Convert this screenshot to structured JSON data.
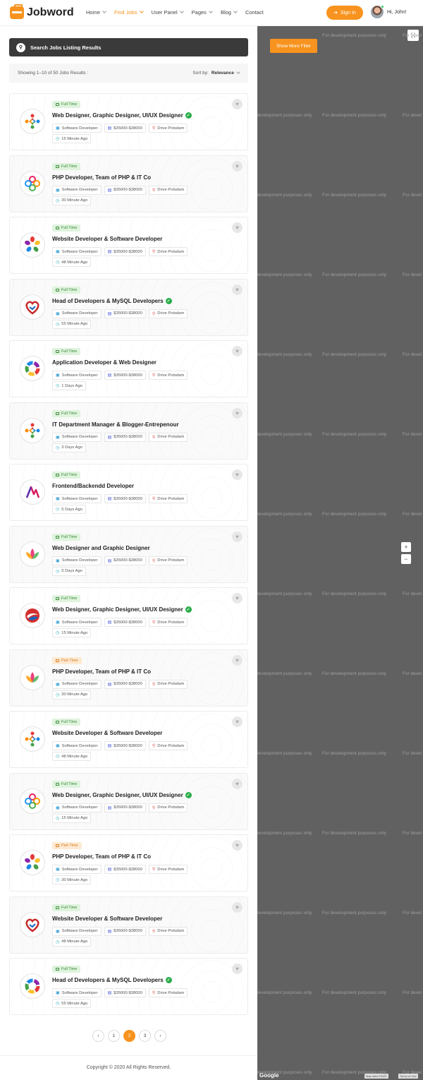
{
  "header": {
    "logo_text": "Jobword",
    "nav": [
      {
        "label": "Home",
        "active": false
      },
      {
        "label": "Find Jobs",
        "active": true
      },
      {
        "label": "User Panel",
        "active": false
      },
      {
        "label": "Pages",
        "active": false
      },
      {
        "label": "Blog",
        "active": false
      },
      {
        "label": "Contact",
        "active": false
      }
    ],
    "signin_label": "Sign In",
    "user_greeting": "Hi, John!"
  },
  "search_bar": {
    "label": "Search Jobs Listing Results"
  },
  "results": {
    "summary": "Showing 1–10 of 50 Jobs Results :",
    "sort_label": "Sort by:",
    "sort_value": "Relevance"
  },
  "jobs": [
    {
      "type": "Full Time",
      "kind": "full",
      "title": "Web Designer, Graphic Designer, UI/UX Designer",
      "verified": true,
      "category": "Software Developer",
      "salary": "$35000-$38000",
      "location": "Drive Potsdam",
      "posted": "15 Minute Ago",
      "logo": "people-logo"
    },
    {
      "type": "Full Time",
      "kind": "full",
      "title": "PHP Developer, Team of PHP & IT Co",
      "verified": false,
      "category": "Software Developer",
      "salary": "$35000-$38000",
      "location": "Drive Potsdam",
      "posted": "30 Minute Ago",
      "logo": "flower-logo"
    },
    {
      "type": "Full Time",
      "kind": "full",
      "title": "Website Developer & Software Developer",
      "verified": false,
      "category": "Software Developer",
      "salary": "$35000-$38000",
      "location": "Drive Potsdam",
      "posted": "48 Minute Ago",
      "logo": "petals-logo"
    },
    {
      "type": "Full Time",
      "kind": "full",
      "title": "Head of Developers & MySQL Developers",
      "verified": true,
      "category": "Software Developer",
      "salary": "$35000-$38000",
      "location": "Drive Potsdam",
      "posted": "55 Minute Ago",
      "logo": "heart-logo"
    },
    {
      "type": "Full Time",
      "kind": "full",
      "title": "Application Developer & Web Designer",
      "verified": false,
      "category": "Software Developer",
      "salary": "$35000-$38000",
      "location": "Drive Potsdam",
      "posted": "1 Days Ago",
      "logo": "ring-logo"
    },
    {
      "type": "Full Time",
      "kind": "full",
      "title": "IT Department Manager & Blogger-Entrepenour",
      "verified": false,
      "category": "Software Developer",
      "salary": "$35000-$38000",
      "location": "Drive Potsdam",
      "posted": "3 Days Ago",
      "logo": "people-logo"
    },
    {
      "type": "Full Time",
      "kind": "full",
      "title": "Frontend/Backendd Developer",
      "verified": false,
      "category": "Software Developer",
      "salary": "$35000-$38000",
      "location": "Drive Potsdam",
      "posted": "5 Days Ago",
      "logo": "letter-logo"
    },
    {
      "type": "Full Time",
      "kind": "full",
      "title": "Web Designer and Graphic Designer",
      "verified": false,
      "category": "Software Developer",
      "salary": "$35000-$38000",
      "location": "Drive Potsdam",
      "posted": "5 Days Ago",
      "logo": "lotus-logo"
    },
    {
      "type": "Full Time",
      "kind": "full",
      "title": "Web Designer, Graphic Designer, UI/UX Designer",
      "verified": true,
      "category": "Software Developer",
      "salary": "$35000-$38000",
      "location": "Drive Potsdam",
      "posted": "15 Minute Ago",
      "logo": "swirl-logo"
    },
    {
      "type": "Part Time",
      "kind": "part",
      "title": "PHP Developer, Team of PHP & IT Co",
      "verified": false,
      "category": "Software Developer",
      "salary": "$35000-$38000",
      "location": "Drive Potsdam",
      "posted": "30 Minute Ago",
      "logo": "lotus-logo"
    },
    {
      "type": "Full Time",
      "kind": "full",
      "title": "Website Developer & Software Developer",
      "verified": false,
      "category": "Software Developer",
      "salary": "$35000-$38000",
      "location": "Drive Potsdam",
      "posted": "48 Minute Ago",
      "logo": "people-logo"
    },
    {
      "type": "Full Time",
      "kind": "full",
      "title": "Web Designer, Graphic Designer, UI/UX Designer",
      "verified": true,
      "category": "Software Developer",
      "salary": "$35000-$38000",
      "location": "Drive Potsdam",
      "posted": "15 Minute Ago",
      "logo": "flower-logo"
    },
    {
      "type": "Part Time",
      "kind": "part",
      "title": "PHP Developer, Team of PHP & IT Co",
      "verified": false,
      "category": "Software Developer",
      "salary": "$35000-$38000",
      "location": "Drive Potsdam",
      "posted": "30 Minute Ago",
      "logo": "petals-logo"
    },
    {
      "type": "Full Time",
      "kind": "full",
      "title": "Website Developer & Software Developer",
      "verified": false,
      "category": "Software Developer",
      "salary": "$35000-$38000",
      "location": "Drive Potsdam",
      "posted": "48 Minute Ago",
      "logo": "heart-logo"
    },
    {
      "type": "Full Time",
      "kind": "full",
      "title": "Head of Developers & MySQL Developers",
      "verified": true,
      "category": "Software Developer",
      "salary": "$35000-$38000",
      "location": "Drive Potsdam",
      "posted": "55 Minute Ago",
      "logo": "ring-logo"
    }
  ],
  "pagination": {
    "pages": [
      "1",
      "2",
      "3"
    ],
    "current": "2"
  },
  "footer": {
    "copyright": "Copyright © 2020 All Rights Reserved."
  },
  "map": {
    "filter_label": "Show More Filter",
    "watermark": "For development purposes only",
    "watermark_clipped": "development purposes only",
    "watermark_short": "For devel",
    "google": "Google",
    "map_data": "Map data ©2020",
    "terms": "Terms of Use"
  },
  "colors": {
    "accent": "#f7931e",
    "full_time": "#3a8a3a",
    "part_time": "#d67b1a",
    "verified": "#2bae4a"
  }
}
